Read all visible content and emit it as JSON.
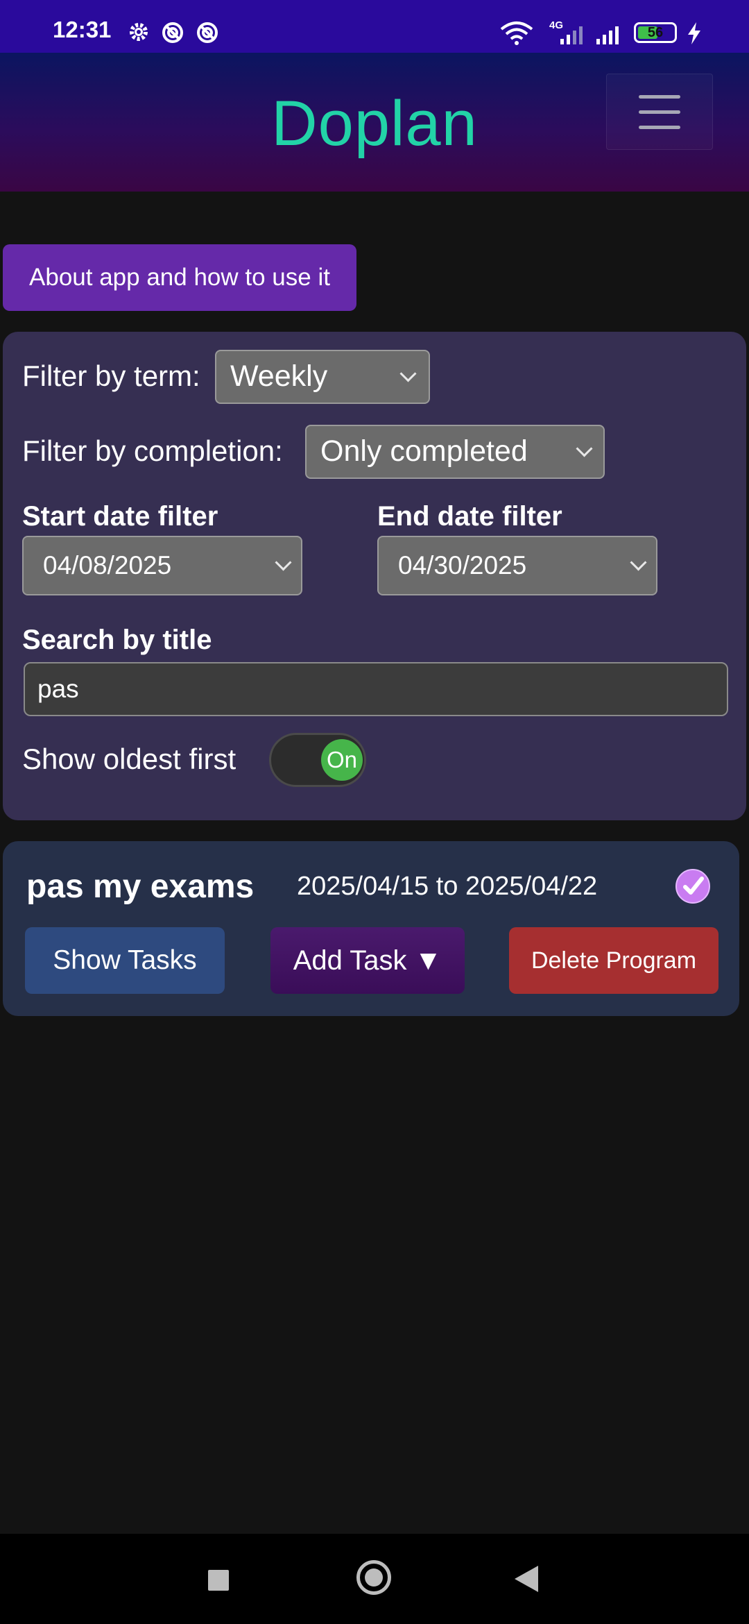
{
  "status": {
    "time": "12:31",
    "network": "4G",
    "battery": "56",
    "icons": [
      "gear-icon",
      "data-saver-icon",
      "data-saver-icon",
      "wifi-icon",
      "signal-icon",
      "signal-icon",
      "battery-icon",
      "charging-icon"
    ]
  },
  "header": {
    "title": "Doplan",
    "menu_icon": "hamburger-menu-icon"
  },
  "about_button": "About app and how to use it",
  "filters": {
    "term_label": "Filter by term:",
    "term_value": "Weekly",
    "completion_label": "Filter by completion:",
    "completion_value": "Only completed",
    "start_label": "Start date filter",
    "start_value": "04/08/2025",
    "end_label": "End date filter",
    "end_value": "04/30/2025",
    "search_label": "Search by title",
    "search_value": "pas",
    "oldest_label": "Show oldest first",
    "oldest_toggle": "On"
  },
  "program": {
    "title": "pas my exams",
    "dates": "2025/04/15 to 2025/04/22",
    "completed_icon": "check-circle-icon",
    "show_tasks": "Show Tasks",
    "add_task": "Add Task ▼",
    "delete_program": "Delete Program"
  },
  "colors": {
    "status_bar": "#2a0a9c",
    "title": "#22d3a7",
    "about_button": "#6529a9",
    "panel": "#362f52",
    "card": "#263049",
    "toggle_on": "#46b54a",
    "delete": "#a62f30"
  }
}
